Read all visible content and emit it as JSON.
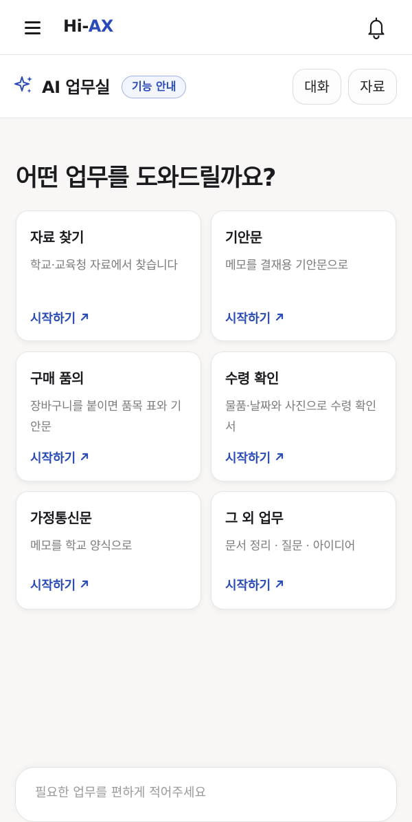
{
  "header": {
    "logo_prefix": "Hi-",
    "logo_accent": "AX",
    "menu_icon": "hamburger-menu-icon",
    "bell_icon": "bell-icon"
  },
  "subheader": {
    "icon": "sparkle-icon",
    "title": "AI 업무실",
    "guide_label": "기능 안내",
    "tabs": [
      "대화",
      "자료"
    ]
  },
  "main": {
    "headline": "어떤 업무를 도와드릴까요?",
    "cards": [
      {
        "title": "자료 찾기",
        "desc": "학교·교육청 자료에서 찾습니다",
        "link": "시작하기"
      },
      {
        "title": "기안문",
        "desc": "메모를 결재용 기안문으로",
        "link": "시작하기"
      },
      {
        "title": "구매 품의",
        "desc": "장바구니를 붙이면 품목 표와 기안문",
        "link": "시작하기"
      },
      {
        "title": "수령 확인",
        "desc": "물품·날짜와 사진으로 수령 확인서",
        "link": "시작하기"
      },
      {
        "title": "가정통신문",
        "desc": "메모를 학교 양식으로",
        "link": "시작하기"
      },
      {
        "title": "그 외 업무",
        "desc": "문서 정리 · 질문 · 아이디어",
        "link": "시작하기"
      }
    ]
  },
  "composer": {
    "placeholder": "필요한 업무를 편하게 적어주세요"
  },
  "colors": {
    "accent": "#2a4bb8",
    "background": "#f8f7f5",
    "card": "#ffffff",
    "muted_text": "#7b7b7b"
  }
}
